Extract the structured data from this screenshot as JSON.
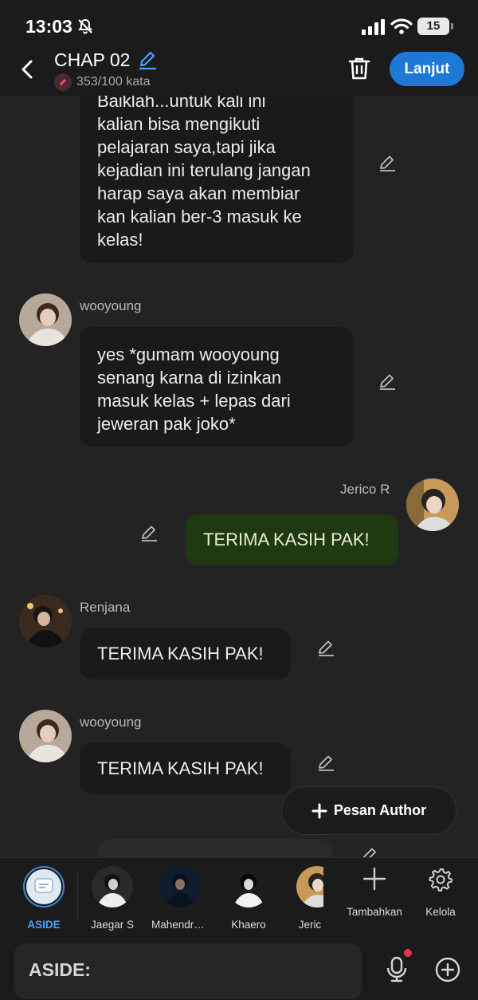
{
  "status_bar": {
    "time": "13:03",
    "battery": "15"
  },
  "header": {
    "title": "CHAP 02",
    "word_count": "353/100 kata",
    "next_label": "Lanjut"
  },
  "messages": [
    {
      "sender": "",
      "text": "Baiklah...untuk kali ini kalian bisa mengikuti pelajaran saya,tapi jika kejadian ini terulang jangan harap saya akan membiar kan kalian ber-3 masuk ke kelas!",
      "lines": [
        "Baiklah...untuk kali ini",
        "kalian bisa mengikuti",
        "pelajaran saya,tapi jika",
        "kejadian ini terulang jangan",
        "harap saya akan membiar",
        "kan kalian ber-3 masuk ke",
        "kelas!"
      ]
    },
    {
      "sender": "wooyoung",
      "lines": [
        "yes *gumam wooyoung",
        "senang karna di izinkan",
        "masuk kelas + lepas dari",
        "jeweran pak joko*"
      ]
    },
    {
      "sender": "Jerico R",
      "text": "TERIMA KASIH PAK!"
    },
    {
      "sender": "Renjana",
      "text": "TERIMA KASIH PAK!"
    },
    {
      "sender": "wooyoung",
      "text": "TERIMA KASIH PAK!"
    }
  ],
  "author_button": "Pesan Author",
  "characters": [
    {
      "name": "ASIDE"
    },
    {
      "name": "Jaegar S"
    },
    {
      "name": "Mahendra..."
    },
    {
      "name": "Khaero"
    },
    {
      "name": "Jeric"
    }
  ],
  "tools": {
    "add": "Tambahkan",
    "manage": "Kelola"
  },
  "input": {
    "label": "ASIDE:"
  },
  "colors": {
    "accent": "#1d78d6",
    "me_bubble": "#1f3a10",
    "background": "#232323"
  }
}
